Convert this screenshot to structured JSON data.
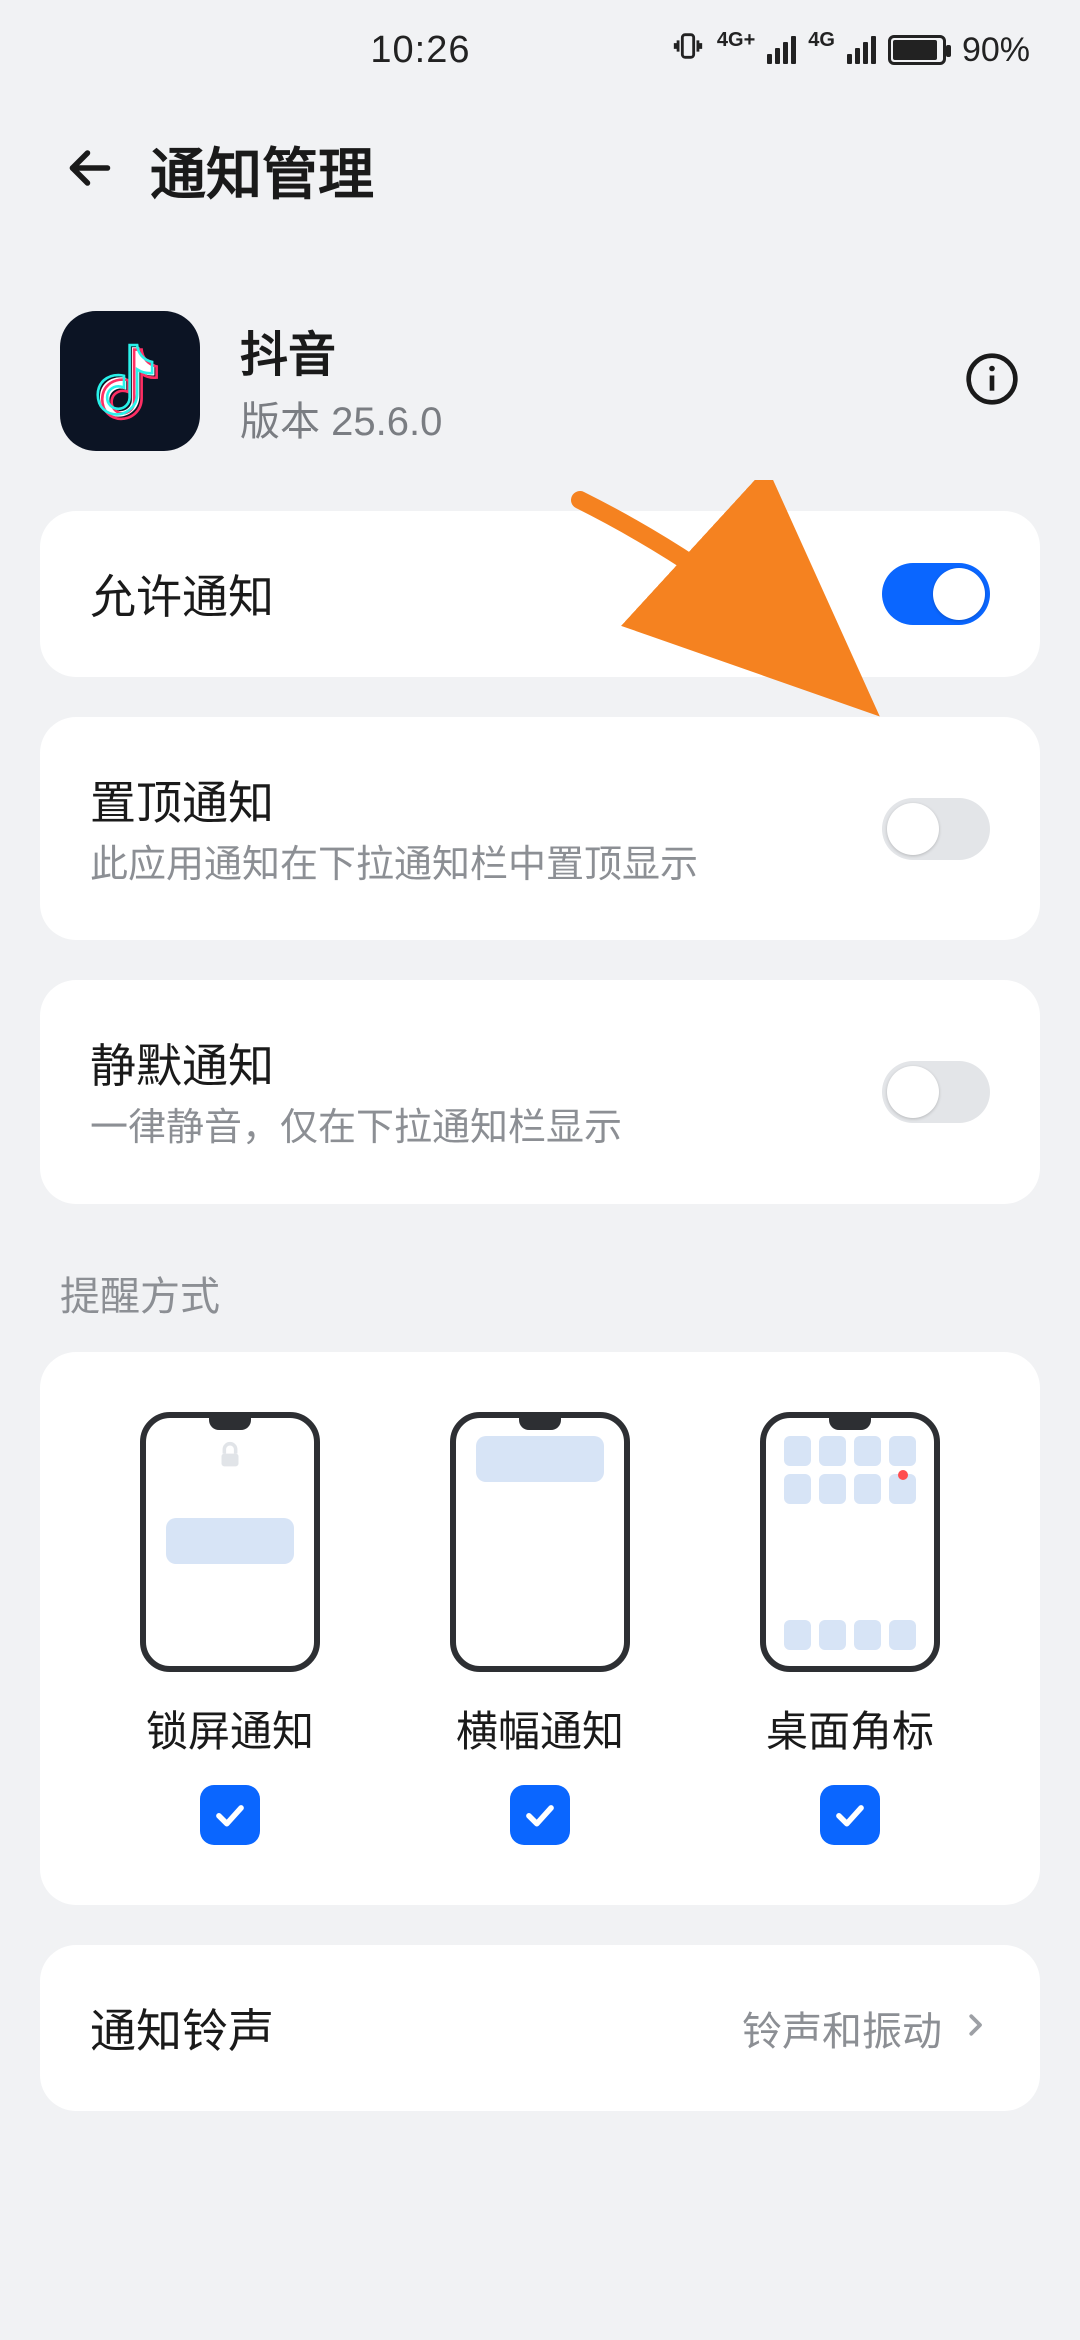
{
  "status": {
    "time": "10:26",
    "net1_label": "4G+",
    "net2_label": "4G",
    "battery_pct": "90%"
  },
  "header": {
    "title": "通知管理"
  },
  "app": {
    "name": "抖音",
    "version_label": "版本 25.6.0"
  },
  "rows": {
    "allow": {
      "title": "允许通知",
      "on": true
    },
    "pin": {
      "title": "置顶通知",
      "sub": "此应用通知在下拉通知栏中置顶显示",
      "on": false
    },
    "silent": {
      "title": "静默通知",
      "sub": "一律静音，仅在下拉通知栏显示",
      "on": false
    },
    "ringtone": {
      "title": "通知铃声",
      "value": "铃声和振动"
    }
  },
  "section": {
    "reminder_label": "提醒方式"
  },
  "modes": {
    "lock": {
      "label": "锁屏通知",
      "checked": true
    },
    "banner": {
      "label": "横幅通知",
      "checked": true
    },
    "badge": {
      "label": "桌面角标",
      "checked": true
    }
  }
}
